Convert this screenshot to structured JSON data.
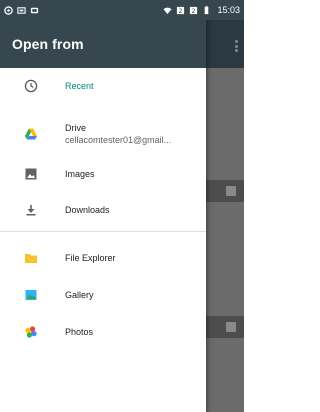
{
  "status_bar": {
    "time": "15:03",
    "icons": [
      "signal-icon",
      "notification-icon",
      "cast-icon",
      "wifi-icon",
      "sim-icon",
      "sim2-icon",
      "battery-icon"
    ]
  },
  "drawer": {
    "title": "Open from",
    "items": [
      {
        "label": "Recent",
        "icon": "clock-icon",
        "selected": true
      },
      {
        "label": "Drive",
        "sublabel": "cellacomtester01@gmail...",
        "icon": "google-drive-icon"
      },
      {
        "label": "Images",
        "icon": "image-icon"
      },
      {
        "label": "Downloads",
        "icon": "download-icon"
      },
      {
        "label": "File Explorer",
        "icon": "folder-icon"
      },
      {
        "label": "Gallery",
        "icon": "gallery-icon"
      },
      {
        "label": "Photos",
        "icon": "google-photos-icon"
      }
    ]
  },
  "colors": {
    "header": "#37474f",
    "accent": "#00897b",
    "text": "#212121"
  }
}
